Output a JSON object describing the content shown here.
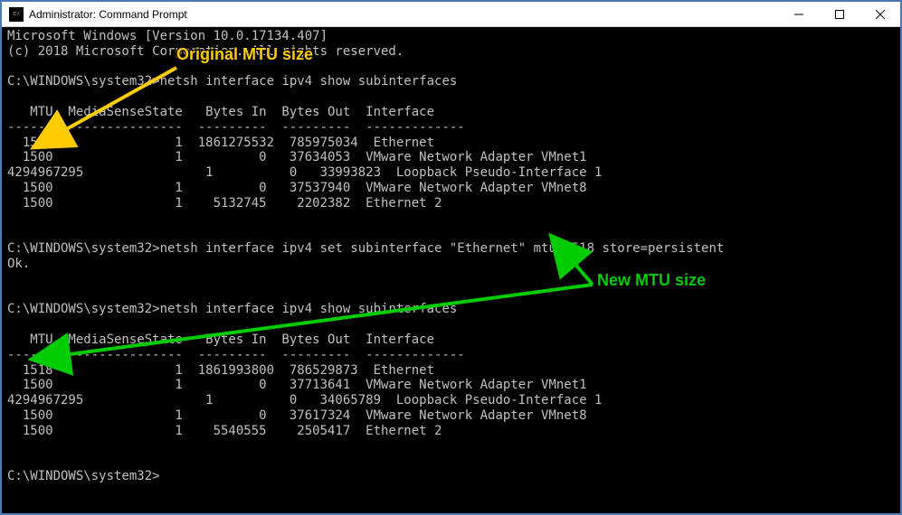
{
  "window": {
    "title": "Administrator: Command Prompt"
  },
  "terminal": {
    "header_line1": "Microsoft Windows [Version 10.0.17134.407]",
    "header_line2": "(c) 2018 Microsoft Corporation. All rights reserved.",
    "blank": "",
    "prompt_path": "C:\\WINDOWS\\system32>",
    "cmd1": "netsh interface ipv4 show subinterfaces",
    "table_header": "   MTU  MediaSenseState   Bytes In  Bytes Out  Interface",
    "table_sep": "------  ---------------  ---------  ---------  -------------",
    "t1r1": "  1500                1  1861275532  785975034  Ethernet",
    "t1r2": "  1500                1          0   37634053  VMware Network Adapter VMnet1",
    "t1r3": "4294967295                1          0   33993823  Loopback Pseudo-Interface 1",
    "t1r4": "  1500                1          0   37537940  VMware Network Adapter VMnet8",
    "t1r5": "  1500                1    5132745    2202382  Ethernet 2",
    "cmd2": "netsh interface ipv4 set subinterface \"Ethernet\" mtu=1518 store=persistent",
    "ok": "Ok.",
    "cmd3": "netsh interface ipv4 show subinterfaces",
    "t2r1": "  1518                1  1861993800  786529873  Ethernet",
    "t2r2": "  1500                1          0   37713641  VMware Network Adapter VMnet1",
    "t2r3": "4294967295                1          0   34065789  Loopback Pseudo-Interface 1",
    "t2r4": "  1500                1          0   37617324  VMware Network Adapter VMnet8",
    "t2r5": "  1500                1    5540555    2505417  Ethernet 2"
  },
  "annotations": {
    "original": "Original MTU size",
    "new": "New MTU size"
  }
}
